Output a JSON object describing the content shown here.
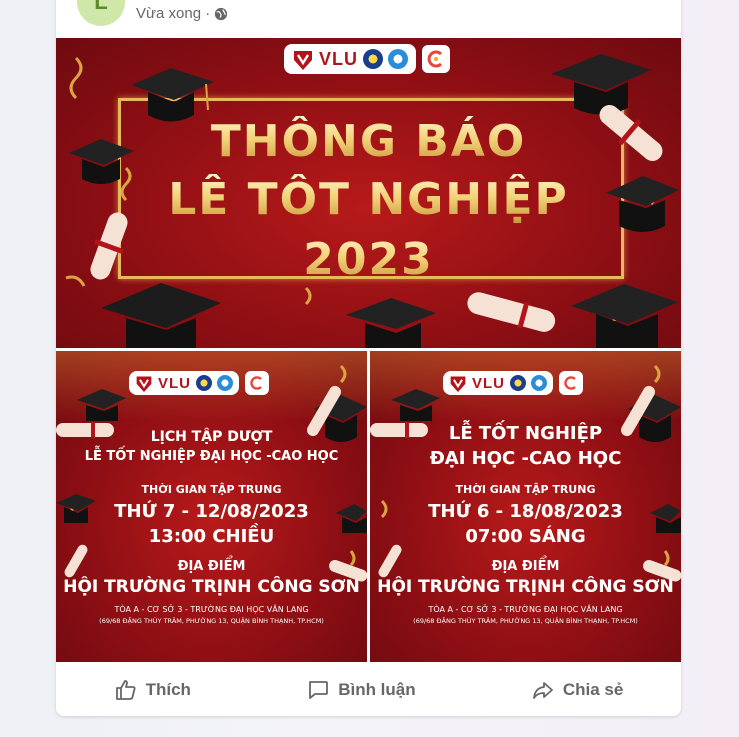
{
  "post": {
    "avatar_letter": "L",
    "time": "Vừa xong ·",
    "privacy_icon": "globe-icon"
  },
  "banner_main": {
    "logo_text": "VLU",
    "line1": "THÔNG BÁO",
    "line2": "LỄ TỐT NGHIỆP",
    "line3": "2023"
  },
  "banner_left": {
    "logo_text": "VLU",
    "title1": "LỊCH TẬP DƯỢT",
    "title2": "LỄ TỐT NGHIỆP ĐẠI HỌC -CAO HỌC",
    "time_label": "THỜI GIAN TẬP TRUNG",
    "date": "THỨ 7 - 12/08/2023",
    "hour": "13:00 CHIỀU",
    "place_label": "ĐỊA ĐIỂM",
    "place": "HỘI TRƯỜNG TRỊNH CÔNG SƠN",
    "addr1": "TÒA A - CƠ SỞ 3 - TRƯỜNG ĐẠI HỌC VĂN LANG",
    "addr2": "(69/68 ĐẶNG THÙY TRÂM, PHƯỜNG 13, QUẬN BÌNH THẠNH, TP.HCM)"
  },
  "banner_right": {
    "logo_text": "VLU",
    "title1": "LỄ TỐT NGHIỆP",
    "title2": "ĐẠI HỌC -CAO HỌC",
    "time_label": "THỜI GIAN TẬP TRUNG",
    "date": "THỨ 6 - 18/08/2023",
    "hour": "07:00 SÁNG",
    "place_label": "ĐỊA ĐIỂM",
    "place": "HỘI TRƯỜNG TRỊNH CÔNG SƠN",
    "addr1": "TÒA A - CƠ SỞ 3 - TRƯỜNG ĐẠI HỌC VĂN LANG",
    "addr2": "(69/68 ĐẶNG THÙY TRÂM, PHƯỜNG 13, QUẬN BÌNH THẠNH, TP.HCM)"
  },
  "actions": {
    "like": "Thích",
    "comment": "Bình luận",
    "share": "Chia sẻ"
  },
  "colors": {
    "banner_red": "#9a1116",
    "gold": "#f3d37a",
    "action_gray": "#65676b"
  }
}
